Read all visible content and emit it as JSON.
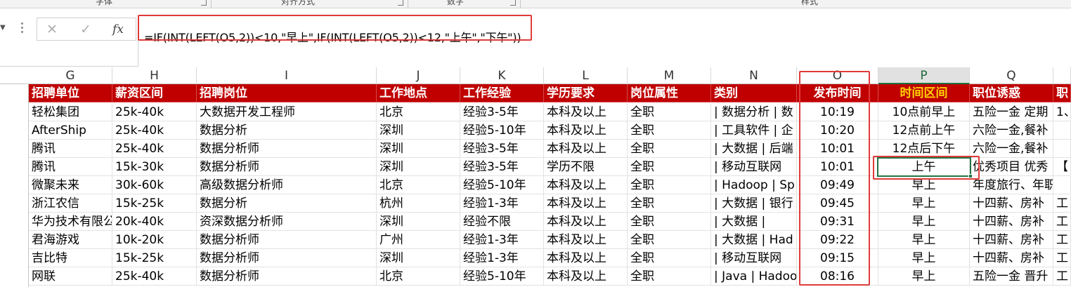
{
  "ribbon": {
    "groups": [
      "字体",
      "对齐方式",
      "数字",
      "样式"
    ]
  },
  "formula_bar": {
    "cancel_icon": "✕",
    "enter_icon": "✓",
    "fx_label": "fx",
    "formula": "=IF(INT(LEFT(O5,2))<10,\"早上\",IF(INT(LEFT(O5,2))<12,\"上午\",\"下午\"))"
  },
  "columns": [
    "G",
    "H",
    "I",
    "J",
    "K",
    "L",
    "M",
    "N",
    "O",
    "P",
    "Q",
    ""
  ],
  "header_row": [
    "招聘单位",
    "薪资区间",
    "招聘岗位",
    "工作地点",
    "工作经验",
    "学历要求",
    "岗位属性",
    "类别",
    "发布时间",
    "时间区间",
    "职位诱惑",
    "职"
  ],
  "rows": [
    [
      "轻松集团",
      "25k-40k",
      "大数据开发工程师",
      "北京",
      "经验3-5年",
      "本科及以上",
      "全职",
      "| 数据分析 | 数",
      "10:19",
      "10点前早上",
      "五险一金 定期",
      "1、"
    ],
    [
      "AfterShip",
      "25k-40k",
      "数据分析",
      "深圳",
      "经验5-10年",
      "本科及以上",
      "全职",
      "| 工具软件 | 企",
      "10:20",
      "12点前上午",
      "六险一金,餐补",
      ""
    ],
    [
      "腾讯",
      "25k-40k",
      "数据分析师",
      "深圳",
      "经验3-5年",
      "本科及以上",
      "全职",
      "| 大数据 | 后端",
      "10:01",
      "12点后下午",
      "六险一金,餐补",
      ""
    ],
    [
      "腾讯",
      "15k-30k",
      "数据分析师",
      "深圳",
      "经验3-5年",
      "学历不限",
      "全职",
      "| 移动互联网",
      "10:01",
      "上午",
      "优秀项目 优秀",
      "【"
    ],
    [
      "微聚未来",
      "30k-60k",
      "高级数据分析师",
      "北京",
      "经验5-10年",
      "本科及以上",
      "全职",
      "| Hadoop | Sp",
      "09:49",
      "早上",
      "年度旅行、年职",
      ""
    ],
    [
      "浙江农信",
      "15k-25k",
      "数据分析",
      "杭州",
      "经验1-3年",
      "本科及以上",
      "全职",
      "| 大数据 | 银行",
      "09:45",
      "早上",
      "十四薪、房补",
      "工"
    ],
    [
      "华为技术有限公司",
      "20k-40k",
      "资深数据分析师",
      "深圳",
      "经验不限",
      "本科及以上",
      "全职",
      "| 大数据 |",
      "09:31",
      "早上",
      "十四薪、房补",
      "工"
    ],
    [
      "君海游戏",
      "10k-20k",
      "数据分析师",
      "广州",
      "经验1-3年",
      "本科及以上",
      "全职",
      "| 大数据 | Had",
      "09:22",
      "早上",
      "十四薪、房补",
      "工"
    ],
    [
      "吉比特",
      "15k-25k",
      "数据分析师",
      "深圳",
      "经验1-3年",
      "本科及以上",
      "全职",
      "| 移动互联网",
      "09:15",
      "早上",
      "十四薪、房补",
      "工"
    ],
    [
      "网联",
      "25k-40k",
      "数据分析师",
      "北京",
      "经验5-10年",
      "本科及以上",
      "全职",
      "| Java | Hadoo",
      "08:16",
      "早上",
      "五险一金 晋升",
      "工"
    ]
  ]
}
